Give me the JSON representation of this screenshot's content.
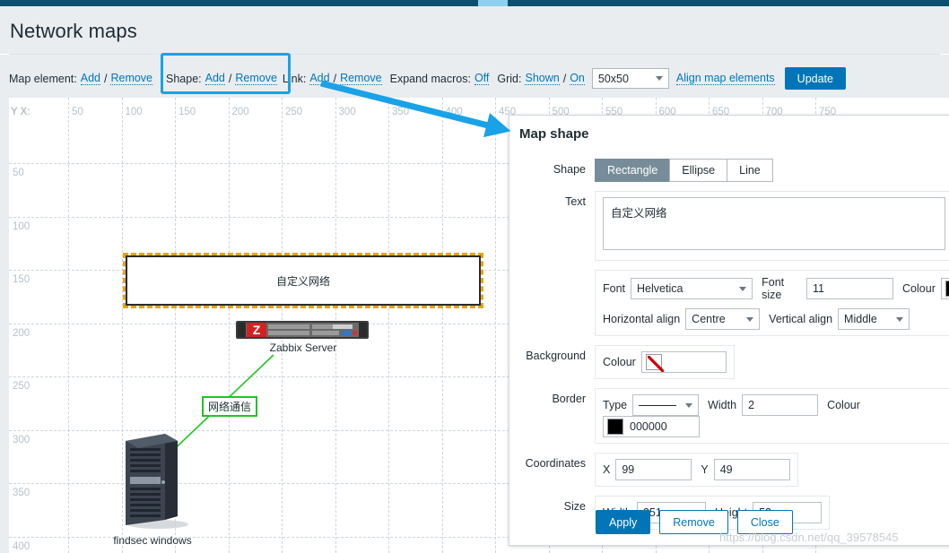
{
  "page": {
    "title": "Network maps"
  },
  "toolbar": {
    "map_element_label": "Map element:",
    "map_element_add": "Add",
    "map_element_remove": "Remove",
    "shape_label": "Shape:",
    "shape_add": "Add",
    "shape_remove": "Remove",
    "link_label": "Link:",
    "link_add": "Add",
    "link_remove": "Remove",
    "expand_macros_label": "Expand macros:",
    "expand_macros_value": "Off",
    "grid_label": "Grid:",
    "grid_shown": "Shown",
    "grid_on": "On",
    "grid_size": "50x50",
    "align_map_elements": "Align map elements",
    "update_label": "Update",
    "separator": "/"
  },
  "map": {
    "axis_corner": "Y X:",
    "x_labels": [
      "50",
      "100",
      "150",
      "200",
      "250",
      "300",
      "350",
      "400",
      "450",
      "500",
      "550",
      "600",
      "650",
      "700",
      "750"
    ],
    "y_labels": [
      "50",
      "100",
      "150",
      "200",
      "250",
      "300",
      "350",
      "400"
    ],
    "shape_text": "自定义网络",
    "link_label": "网络通信",
    "nodes": [
      {
        "id": "zabbix-server",
        "label": "Zabbix Server"
      },
      {
        "id": "findsec-windows",
        "label": "findsec windows"
      }
    ],
    "link_colour": "#21c521",
    "selection_colour": "#e8a317"
  },
  "dialog": {
    "title": "Map shape",
    "shape": {
      "label": "Shape",
      "options": [
        "Rectangle",
        "Ellipse",
        "Line"
      ],
      "selected": "Rectangle"
    },
    "text": {
      "label": "Text",
      "value": "自定义网络"
    },
    "font": {
      "label": "Font",
      "value": "Helvetica",
      "size_label": "Font size",
      "size_value": "11",
      "colour_label": "Colour",
      "colour_value": "#000000"
    },
    "align": {
      "horizontal_label": "Horizontal align",
      "horizontal_value": "Centre",
      "vertical_label": "Vertical align",
      "vertical_value": "Middle"
    },
    "background": {
      "label": "Background",
      "colour_label": "Colour",
      "colour_value": ""
    },
    "border": {
      "label": "Border",
      "type_label": "Type",
      "type_value": "solid",
      "width_label": "Width",
      "width_value": "2",
      "colour_label": "Colour",
      "colour_value": "000000"
    },
    "coordinates": {
      "label": "Coordinates",
      "x_label": "X",
      "x_value": "99",
      "y_label": "Y",
      "y_value": "49"
    },
    "size": {
      "label": "Size",
      "width_label": "Width",
      "width_value": "351",
      "height_label": "Height",
      "height_value": "52"
    },
    "buttons": {
      "apply": "Apply",
      "remove": "Remove",
      "close": "Close"
    }
  },
  "watermark": "https://blog.csdn.net/qq_39578545"
}
